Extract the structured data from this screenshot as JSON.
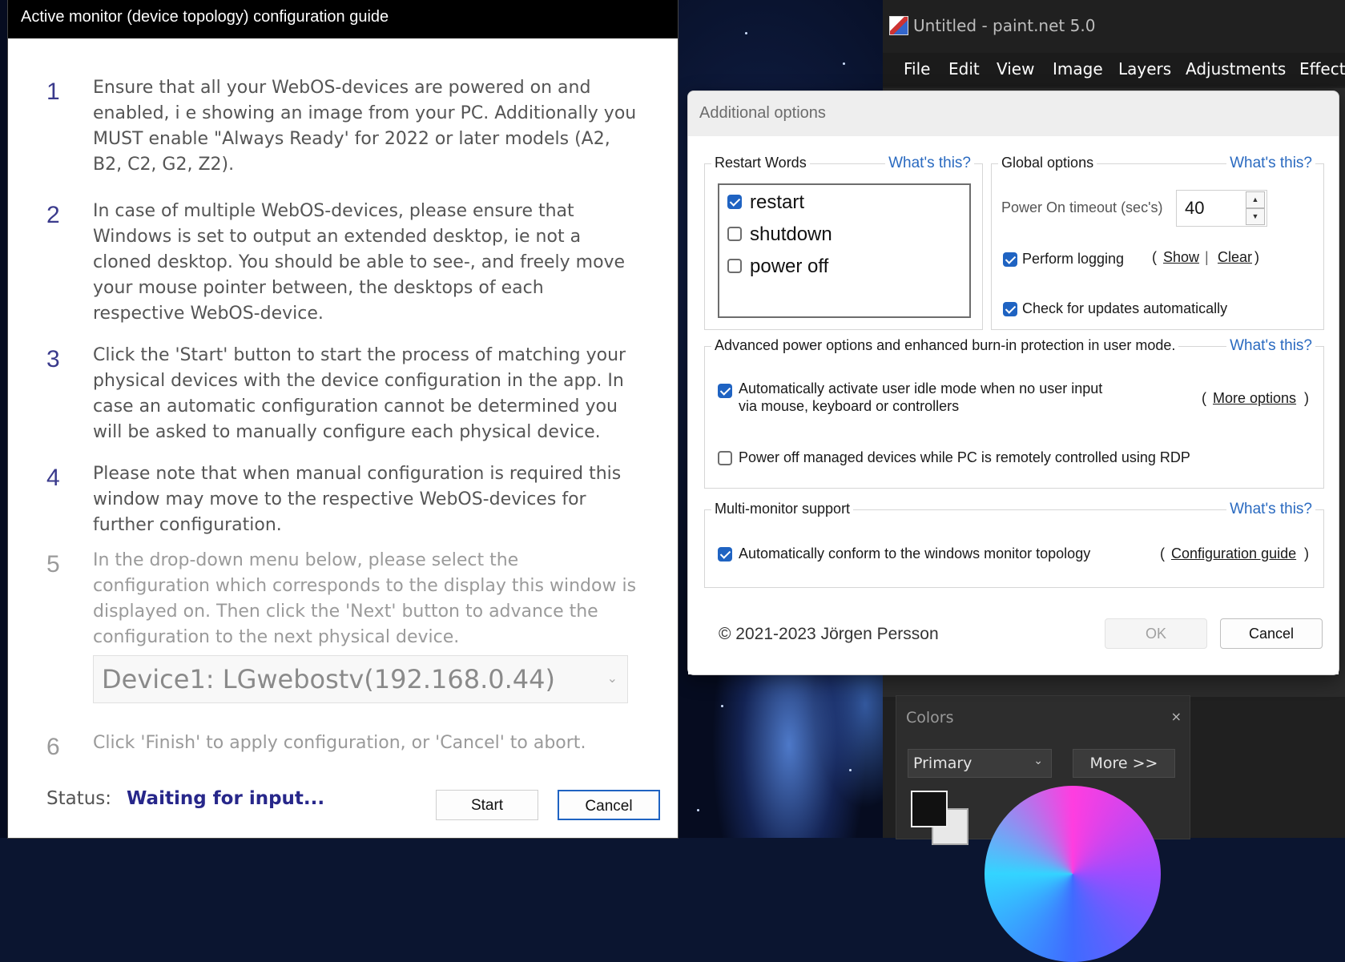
{
  "paint": {
    "title": "Untitled - paint.net 5.0",
    "menu": [
      "File",
      "Edit",
      "View",
      "Image",
      "Layers",
      "Adjustments",
      "Effects"
    ],
    "colors_panel": {
      "title": "Colors",
      "close": "×",
      "primary_select": "Primary",
      "more_button": "More >>"
    }
  },
  "options_dialog": {
    "title": "Additional options",
    "whats_this": "What's this?",
    "restart_words": {
      "legend": "Restart Words",
      "items": [
        {
          "label": "restart",
          "checked": true
        },
        {
          "label": "shutdown",
          "checked": false
        },
        {
          "label": "power off",
          "checked": false
        }
      ]
    },
    "global_options": {
      "legend": "Global options",
      "timeout_label": "Power On timeout (sec's)",
      "timeout_value": "40",
      "perform_logging": {
        "label": "Perform logging",
        "checked": true
      },
      "show_link": "Show",
      "clear_link": "Clear",
      "check_updates": {
        "label": "Check for updates automatically",
        "checked": true
      }
    },
    "advanced": {
      "legend": "Advanced power options and enhanced burn-in protection in user mode.",
      "idle_mode": {
        "line1": "Automatically activate user idle mode when no user input",
        "line2": "via mouse, keyboard or controllers",
        "checked": true
      },
      "more_options_link": "More options",
      "rdp": {
        "label": "Power off managed devices while PC is remotely controlled using RDP",
        "checked": false
      }
    },
    "multi_monitor": {
      "legend": "Multi-monitor support",
      "conform": {
        "label": "Automatically conform to the windows monitor topology",
        "checked": true
      },
      "config_guide_link": "Configuration guide"
    },
    "copyright": "© 2021-2023 Jörgen Persson",
    "ok_button": "OK",
    "cancel_button": "Cancel"
  },
  "guide": {
    "title": "Active monitor (device topology) configuration guide",
    "steps": [
      {
        "num": "1",
        "text": "Ensure that all your WebOS-devices are powered on and enabled, i e showing an image from your PC. Additionally you MUST enable \"Always Ready' for 2022 or later models (A2, B2, C2, G2, Z2)."
      },
      {
        "num": "2",
        "text": "In case of multiple WebOS-devices, please ensure that Windows is set to output an extended desktop, ie not a cloned desktop. You should be able to see-, and freely move your mouse pointer between, the desktops of each respective WebOS-device."
      },
      {
        "num": "3",
        "text": "Click the 'Start' button to start the process of matching your physical devices with the device configuration in the app. In case an automatic configuration cannot be determined you will be asked to manually configure each physical device."
      },
      {
        "num": "4",
        "text": "Please note that when manual configuration is required this window may move to the respective WebOS-devices for further configuration."
      },
      {
        "num": "5",
        "text": "In the drop-down menu below, please select the configuration which corresponds to the display this window is displayed on. Then click the 'Next' button to advance the configuration to the next physical device."
      },
      {
        "num": "6",
        "text": "Click 'Finish' to apply configuration, or 'Cancel' to abort."
      }
    ],
    "device_select": "Device1: LGwebostv(192.168.0.44)",
    "status_label": "Status:",
    "status_value": "Waiting for input...",
    "start_button": "Start",
    "cancel_button": "Cancel"
  }
}
